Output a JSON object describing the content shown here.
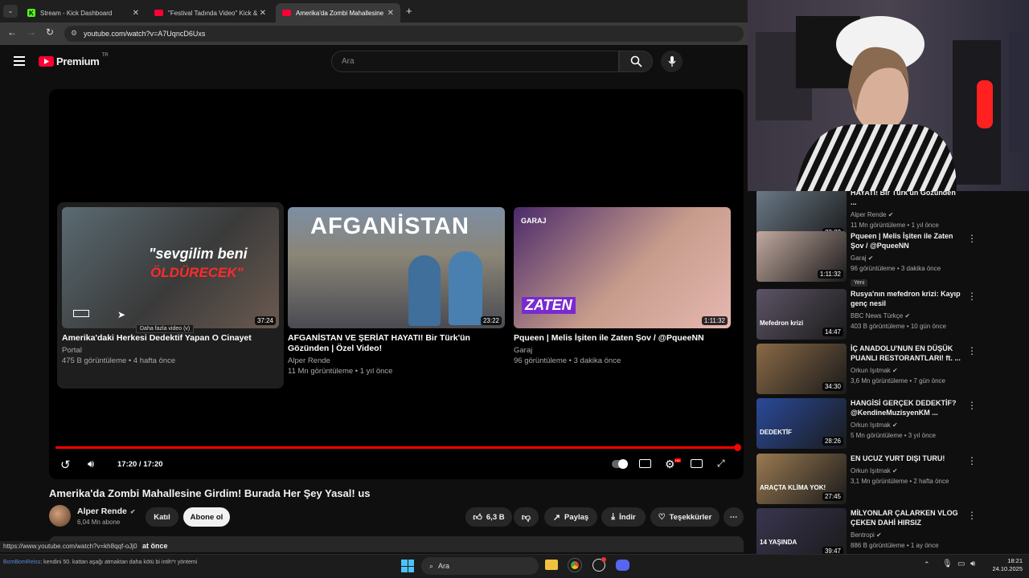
{
  "tabs": [
    {
      "label": "Stream - Kick Dashboard"
    },
    {
      "label": "\"Festival Tadında Video\" Kick &"
    },
    {
      "label": "Amerika'da Zombi Mahallesine"
    }
  ],
  "address": {
    "url": "youtube.com/watch?v=A7UqncD6Uxs"
  },
  "header": {
    "brand": "Premium",
    "region": "TR",
    "search_placeholder": "Ara"
  },
  "player": {
    "time": "17:20 / 17:20",
    "progress_fraction": 1.0,
    "tooltip": "Daha fazla video (v)",
    "endscreen": [
      {
        "title": "Amerika'daki Herkesi Dedektif Yapan O Cinayet",
        "channel": "Portal",
        "meta": "475 B görüntüleme • 4 hafta önce",
        "duration": "37:24",
        "thumb_text1": "\"sevgilim beni",
        "thumb_text2": "ÖLDÜRECEK\""
      },
      {
        "title": "AFGANİSTAN VE ŞERİAT HAYATI! Bir Türk'ün Gözünden | Özel Video!",
        "channel": "Alper Rende",
        "meta": "11 Mn görüntüleme • 1 yıl önce",
        "duration": "23:22",
        "thumb_text1": "AFGANİSTAN"
      },
      {
        "title": "Pqueen | Melis İşiten ile Zaten Şov / @PqueeNN",
        "channel": "Garaj",
        "meta": "96 görüntüleme • 3 dakika önce",
        "duration": "1:11:32",
        "thumb_text1": "GARAJ",
        "thumb_text2": "ZATEN"
      }
    ]
  },
  "video": {
    "title": "Amerika'da Zombi Mahallesine Girdim! Burada Her Şey Yasal! us",
    "channel": "Alper Rende",
    "subscribers": "6,04 Mn abone",
    "join_label": "Katıl",
    "subscribe_label": "Abone ol",
    "likes": "6,3 B",
    "share_label": "Paylaş",
    "download_label": "İndir",
    "thanks_label": "Teşekkürler",
    "desc_snippet": "at önce"
  },
  "status_url": "https://www.youtube.com/watch?v=kh8qqf-oJj0",
  "sidebar": [
    {
      "title": "HAYATI! Bir Türk'ün Gözünden ...",
      "channel": "Alper Rende",
      "meta": "11 Mn görüntüleme • 1 yıl önce",
      "duration": "23:22",
      "color": "#6b7a88"
    },
    {
      "title": "Pqueen | Melis İşiten ile Zaten Şov / @PqueeNN",
      "channel": "Garaj",
      "meta": "96 görüntüleme • 3 dakika önce",
      "badge": "Yeni",
      "duration": "1:11:32",
      "color": "#c3a9a0"
    },
    {
      "title": "Rusya'nın mefedron krizi: Kayıp genç nesil",
      "channel": "BBC News Türkçe",
      "meta": "403 B görüntüleme • 10 gün önce",
      "duration": "14:47",
      "thumb_text": "Mefedron krizi",
      "color": "#5d5466"
    },
    {
      "title": "İÇ ANADOLU'NUN EN DÜŞÜK PUANLI RESTORANTLARI! ft. ...",
      "channel": "Orkun Işıtmak",
      "meta": "3,6 Mn görüntüleme • 7 gün önce",
      "duration": "34:30",
      "color": "#8a6a46"
    },
    {
      "title": "HANGİSİ GERÇEK DEDEKTİF? @KendineMuzisyenKM ...",
      "channel": "Orkun Işıtmak",
      "meta": "5 Mn görüntüleme • 3 yıl önce",
      "duration": "28:26",
      "thumb_text": "DEDEKTİF",
      "color": "#2a4a9a"
    },
    {
      "title": "EN UCUZ YURT DIŞI TURU!",
      "channel": "Orkun Işıtmak",
      "meta": "3,1 Mn görüntüleme • 2 hafta önce",
      "duration": "27:45",
      "thumb_text": "ARAÇTA KLİMA YOK!",
      "color": "#9a7a52"
    },
    {
      "title": "MİLYONLAR ÇALARKEN VLOG ÇEKEN DAHİ HIRSIZ",
      "channel": "Bentropi",
      "meta": "886 B görüntüleme • 1 ay önce",
      "duration": "39:47",
      "thumb_text": "14 YAŞINDA",
      "color": "#3a3550"
    }
  ],
  "chat": {
    "user": "BomBomReiss",
    "message": ": kendini 50. kattan aşağı atmaktan daha kötü bi intih*r yöntemi"
  },
  "taskbar": {
    "search": "Ara",
    "time": "18:21",
    "date": "24.10.2025"
  }
}
